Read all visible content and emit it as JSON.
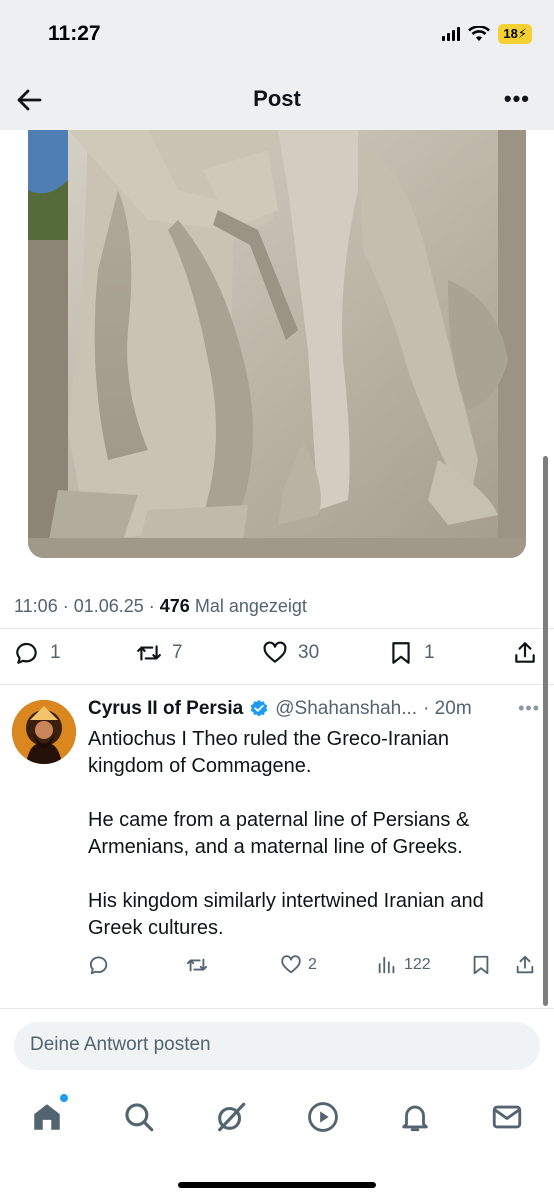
{
  "status_bar": {
    "time": "11:27",
    "battery": "18"
  },
  "header": {
    "title": "Post"
  },
  "post": {
    "timestamp": "11:06 · 01.06.25 · ",
    "views_count": "476",
    "views_label": " Mal angezeigt",
    "stats": {
      "replies": "1",
      "reposts": "7",
      "likes": "30",
      "bookmarks": "1"
    }
  },
  "reply": {
    "author_name": "Cyrus II of Persia",
    "handle": "@Shahanshah...",
    "time": "· 20m",
    "paragraphs": [
      "Antiochus I Theo ruled the Greco-Iranian kingdom of Commagene.",
      "He came from a paternal line of Persians & Armenians, and a maternal line of Greeks.",
      "His kingdom similarly intertwined Iranian and Greek cultures."
    ],
    "likes": "2",
    "views": "122"
  },
  "compose": {
    "placeholder": "Deine Antwort posten"
  },
  "colors": {
    "accent": "#1d9bf0",
    "verified": "#1d9bf0",
    "muted": "#536471"
  },
  "tabs": [
    "home-icon",
    "search-icon",
    "grok-icon",
    "video-icon",
    "notifications-icon",
    "messages-icon"
  ]
}
